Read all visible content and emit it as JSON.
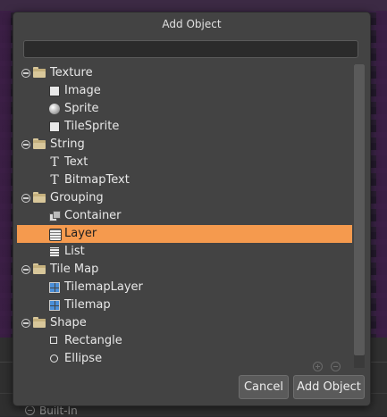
{
  "dialog": {
    "title": "Add Object",
    "search": {
      "value": "",
      "placeholder": ""
    },
    "tree": [
      {
        "label": "Texture",
        "type": "folder"
      },
      {
        "label": "Image",
        "icon": "image-icon"
      },
      {
        "label": "Sprite",
        "icon": "sprite-icon"
      },
      {
        "label": "TileSprite",
        "icon": "tilesprite-icon"
      },
      {
        "label": "String",
        "type": "folder"
      },
      {
        "label": "Text",
        "icon": "text-icon"
      },
      {
        "label": "BitmapText",
        "icon": "bitmaptext-icon"
      },
      {
        "label": "Grouping",
        "type": "folder"
      },
      {
        "label": "Container",
        "icon": "container-icon"
      },
      {
        "label": "Layer",
        "icon": "layer-icon",
        "selected": true
      },
      {
        "label": "List",
        "icon": "list-icon"
      },
      {
        "label": "Tile Map",
        "type": "folder"
      },
      {
        "label": "TilemapLayer",
        "icon": "tilemap-layer-icon"
      },
      {
        "label": "Tilemap",
        "icon": "tilemap-icon"
      },
      {
        "label": "Shape",
        "type": "folder"
      },
      {
        "label": "Rectangle",
        "icon": "rectangle-icon"
      },
      {
        "label": "Ellipse",
        "icon": "ellipse-icon"
      }
    ],
    "buttons": {
      "cancel": "Cancel",
      "add": "Add Object"
    },
    "selection_color": "#f59a4e"
  },
  "background": {
    "builtin_label": "Built-In"
  }
}
